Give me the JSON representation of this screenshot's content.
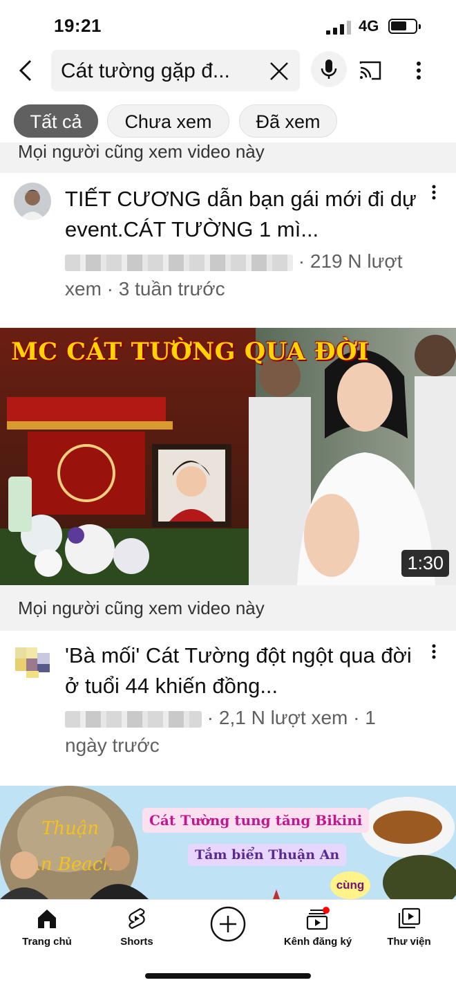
{
  "status_bar": {
    "time": "19:21",
    "network": "4G"
  },
  "search": {
    "query": "Cát tường gặp đ..."
  },
  "chips": [
    {
      "label": "Tất cả",
      "active": true
    },
    {
      "label": "Chưa xem",
      "active": false
    },
    {
      "label": "Đã xem",
      "active": false
    }
  ],
  "section_header_top": "Mọi người cũng xem video này",
  "video1": {
    "title": "TIẾT CƯƠNG dẫn bạn gái mới đi dự event.CÁT TƯỜNG 1 mì...",
    "meta_views": "· 219 N lượt",
    "meta_views_rest": "xem · 3 tuần trước"
  },
  "featured": {
    "overlay_title": "MC CÁT TƯỜNG QUA ĐỜI",
    "duration": "1:30"
  },
  "section_header": "Mọi người cũng xem video này",
  "video2": {
    "title": "'Bà mối' Cát Tường đột ngột qua đời ở tuổi 44 khiến đồng...",
    "meta_views": "· 2,1 N lượt xem · 1",
    "meta_views_rest": "ngày trước"
  },
  "banner": {
    "line1": "Cát Tường tung tăng Bikini",
    "line2": "Tắm biển Thuận An",
    "line3": "cùng"
  },
  "tabs": {
    "home": "Trang chủ",
    "shorts": "Shorts",
    "subscriptions": "Kênh đăng ký",
    "library": "Thư viện"
  },
  "colors": {
    "notification_dot": "#ff0000",
    "title_overlay": "#ffd400"
  }
}
